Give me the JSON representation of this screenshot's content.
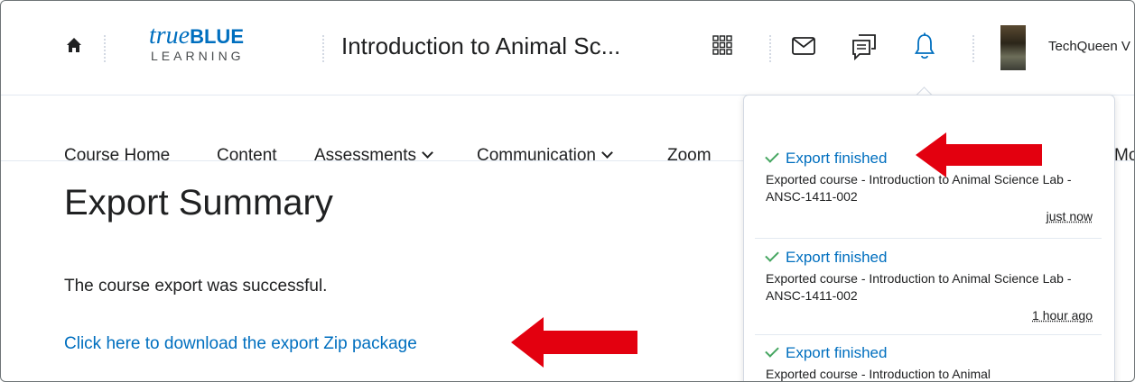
{
  "header": {
    "logo_main": "true",
    "logo_bold": "BLUE",
    "logo_sub": "LEARNING",
    "course_title": "Introduction to Animal Sc...",
    "username": "TechQueen V"
  },
  "nav": {
    "items": [
      {
        "label": "Course Home",
        "dropdown": false
      },
      {
        "label": "Content",
        "dropdown": false
      },
      {
        "label": "Assessments",
        "dropdown": true
      },
      {
        "label": "Communication",
        "dropdown": true
      },
      {
        "label": "Zoom",
        "dropdown": false
      }
    ],
    "more_partial": "Mo"
  },
  "main": {
    "title": "Export Summary",
    "message": "The course export was successful.",
    "download_link": "Click here to download the export Zip package"
  },
  "notifications": [
    {
      "title": "Export finished",
      "description": "Exported course - Introduction to Animal Science Lab - ANSC-1411-002",
      "time": "just now"
    },
    {
      "title": "Export finished",
      "description": "Exported course - Introduction to Animal Science Lab - ANSC-1411-002",
      "time": "1 hour ago"
    },
    {
      "title": "Export finished",
      "description": "Exported course - Introduction to Animal",
      "time": ""
    }
  ],
  "colors": {
    "link": "#006fbf",
    "check": "#46a661",
    "arrow": "#e3000f",
    "text": "#202122"
  },
  "icons": [
    "home-icon",
    "app-grid-icon",
    "mail-icon",
    "chat-icon",
    "bell-icon",
    "check-icon",
    "chevron-down-icon",
    "red-arrow-annotation"
  ]
}
